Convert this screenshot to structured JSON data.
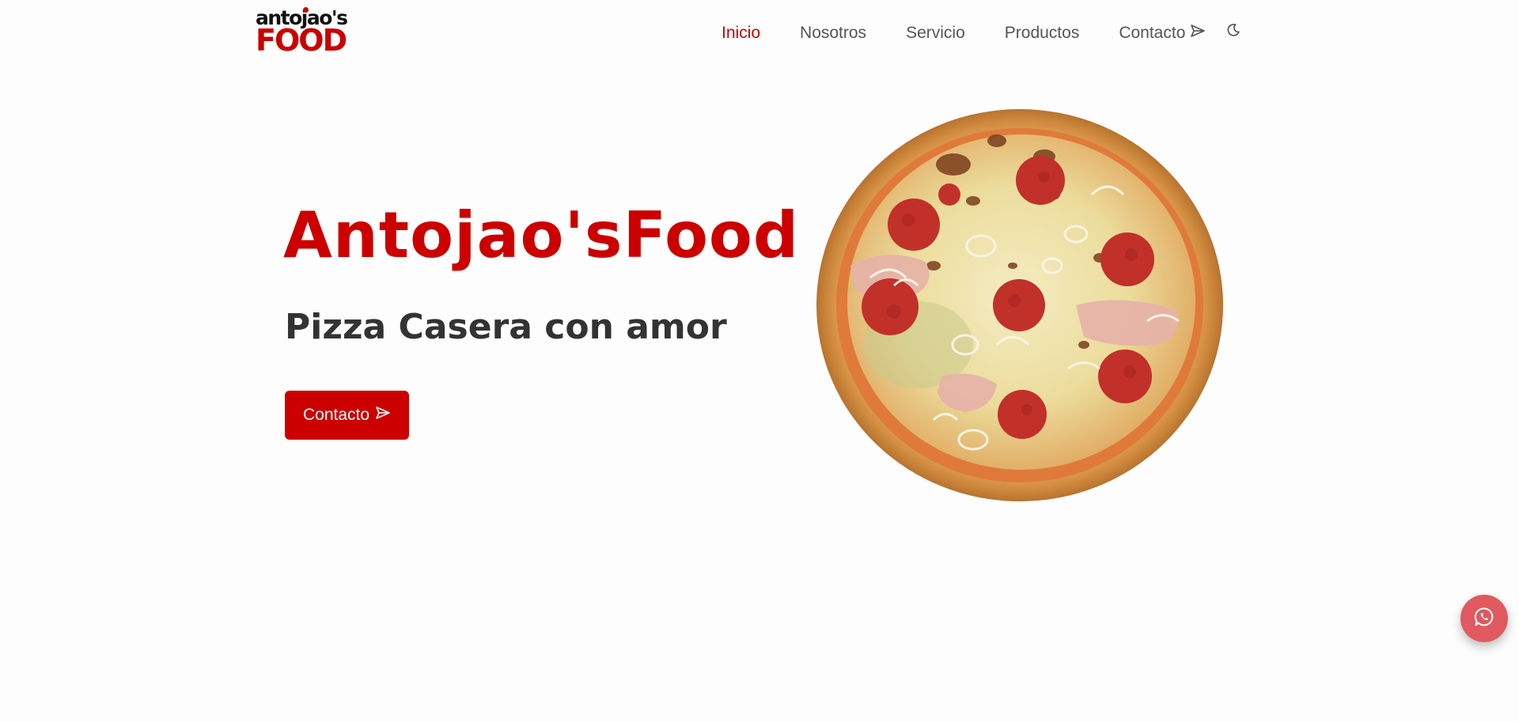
{
  "brand": {
    "logo_top": "antojao's",
    "logo_bottom": "FOOD"
  },
  "nav": {
    "items": [
      {
        "label": "Inicio",
        "active": true
      },
      {
        "label": "Nosotros",
        "active": false
      },
      {
        "label": "Servicio",
        "active": false
      },
      {
        "label": "Productos",
        "active": false
      },
      {
        "label": "Contacto",
        "active": false,
        "icon": "send-icon"
      }
    ],
    "theme_toggle_icon": "moon-icon"
  },
  "hero": {
    "title": "Antojao'sFood",
    "subtitle": "Pizza Casera con amor",
    "button_label": "Contacto",
    "button_icon": "send-icon",
    "image_icon": "pizza-image"
  },
  "floating": {
    "icon": "whatsapp-icon"
  },
  "colors": {
    "accent": "#cc0000",
    "text": "#333333",
    "nav_text": "#555555",
    "background": "#fdfdfd",
    "whatsapp_button": "#e05a5f"
  }
}
